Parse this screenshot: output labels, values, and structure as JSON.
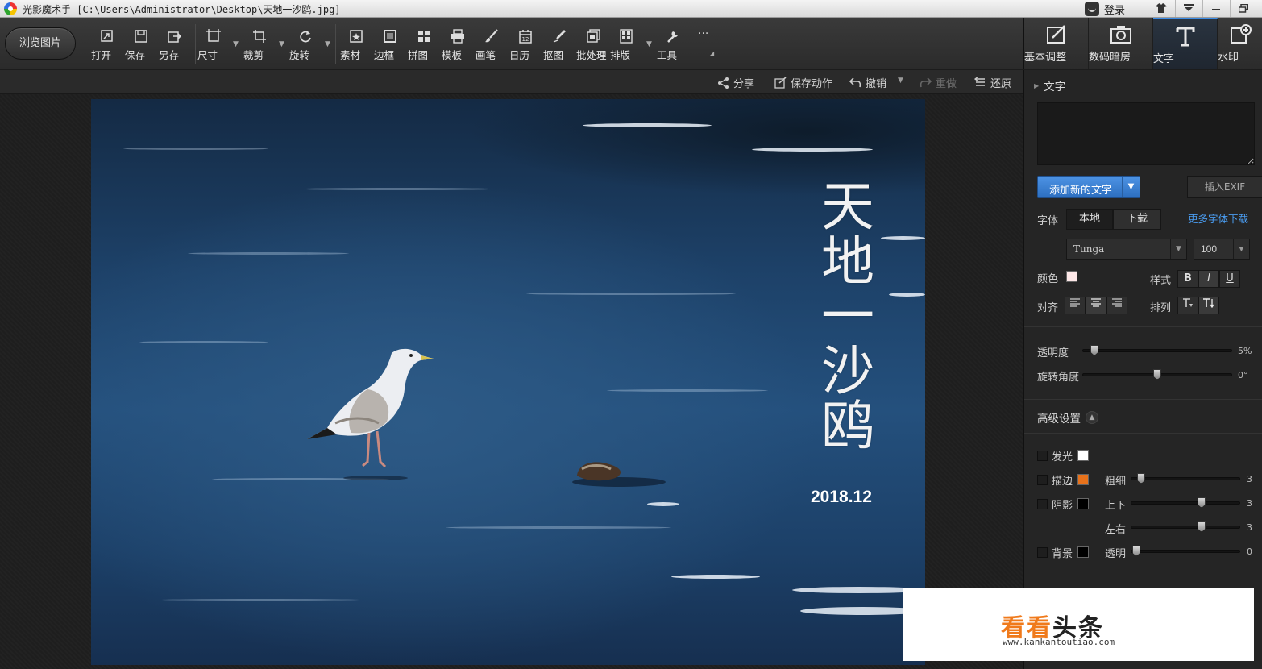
{
  "window": {
    "title": "光影魔术手 [C:\\Users\\Administrator\\Desktop\\天地一沙鸥.jpg]",
    "login_label": "登录"
  },
  "toolbar": {
    "browse_label": "浏览图片",
    "tools": [
      {
        "label": "打开",
        "icon": "open-icon"
      },
      {
        "label": "保存",
        "icon": "save-icon"
      },
      {
        "label": "另存",
        "icon": "save-as-icon"
      },
      {
        "label": "尺寸",
        "icon": "resize-icon"
      },
      {
        "label": "裁剪",
        "icon": "crop-icon"
      },
      {
        "label": "旋转",
        "icon": "rotate-icon"
      },
      {
        "label": "素材",
        "icon": "material-icon"
      },
      {
        "label": "边框",
        "icon": "border-icon"
      },
      {
        "label": "拼图",
        "icon": "collage-icon"
      },
      {
        "label": "模板",
        "icon": "template-icon"
      },
      {
        "label": "画笔",
        "icon": "brush-icon"
      },
      {
        "label": "日历",
        "icon": "calendar-icon"
      },
      {
        "label": "抠图",
        "icon": "cutout-icon"
      },
      {
        "label": "批处理",
        "icon": "batch-icon"
      },
      {
        "label": "排版",
        "icon": "layout-icon"
      },
      {
        "label": "工具",
        "icon": "wrench-icon"
      }
    ],
    "more": "···"
  },
  "right_tabs": [
    {
      "label": "基本调整",
      "icon": "adjust-icon"
    },
    {
      "label": "数码暗房",
      "icon": "camera-icon"
    },
    {
      "label": "文字",
      "icon": "text-icon",
      "active": true
    },
    {
      "label": "水印",
      "icon": "watermark-icon"
    }
  ],
  "actions": {
    "share": "分享",
    "save_action": "保存动作",
    "undo": "撤销",
    "redo": "重做",
    "restore": "还原"
  },
  "photo": {
    "title_text": "天地一沙鸥",
    "date_text": "2018.12"
  },
  "page_watermark": {
    "brand_part1": "看看",
    "brand_part2": "头条",
    "url": "www.kankantoutiao.com"
  },
  "text_panel": {
    "section_title": "文字",
    "add_text_button": "添加新的文字",
    "insert_exif_button": "插入EXIF",
    "font_label": "字体",
    "font_local": "本地",
    "font_download": "下载",
    "more_fonts_link": "更多字体下载",
    "font_name": "Tunga",
    "font_size": "100",
    "color_label": "颜色",
    "style_label": "样式",
    "bold": "B",
    "italic": "I",
    "underline": "U",
    "align_label": "对齐",
    "arrange_label": "排列",
    "opacity_label": "透明度",
    "opacity_value": "5%",
    "opacity_level": 0.05,
    "rotation_label": "旋转角度",
    "rotation_value": "0°",
    "rotation_level": 0.5,
    "colors": {
      "text": "#fde7e7",
      "glow": "#ffffff",
      "stroke": "#e8721b",
      "shadow": "#000000",
      "background": "#000000",
      "accent": "#3a8be6"
    }
  },
  "advanced": {
    "title": "高级设置",
    "glow_label": "发光",
    "stroke_label": "描边",
    "thickness_label": "粗细",
    "thickness_value": "3",
    "shadow_label": "阴影",
    "updown_label": "上下",
    "updown_value": "3",
    "leftright_label": "左右",
    "leftright_value": "3",
    "background_label": "背景",
    "transparent_label": "透明",
    "transparent_value": "0"
  }
}
